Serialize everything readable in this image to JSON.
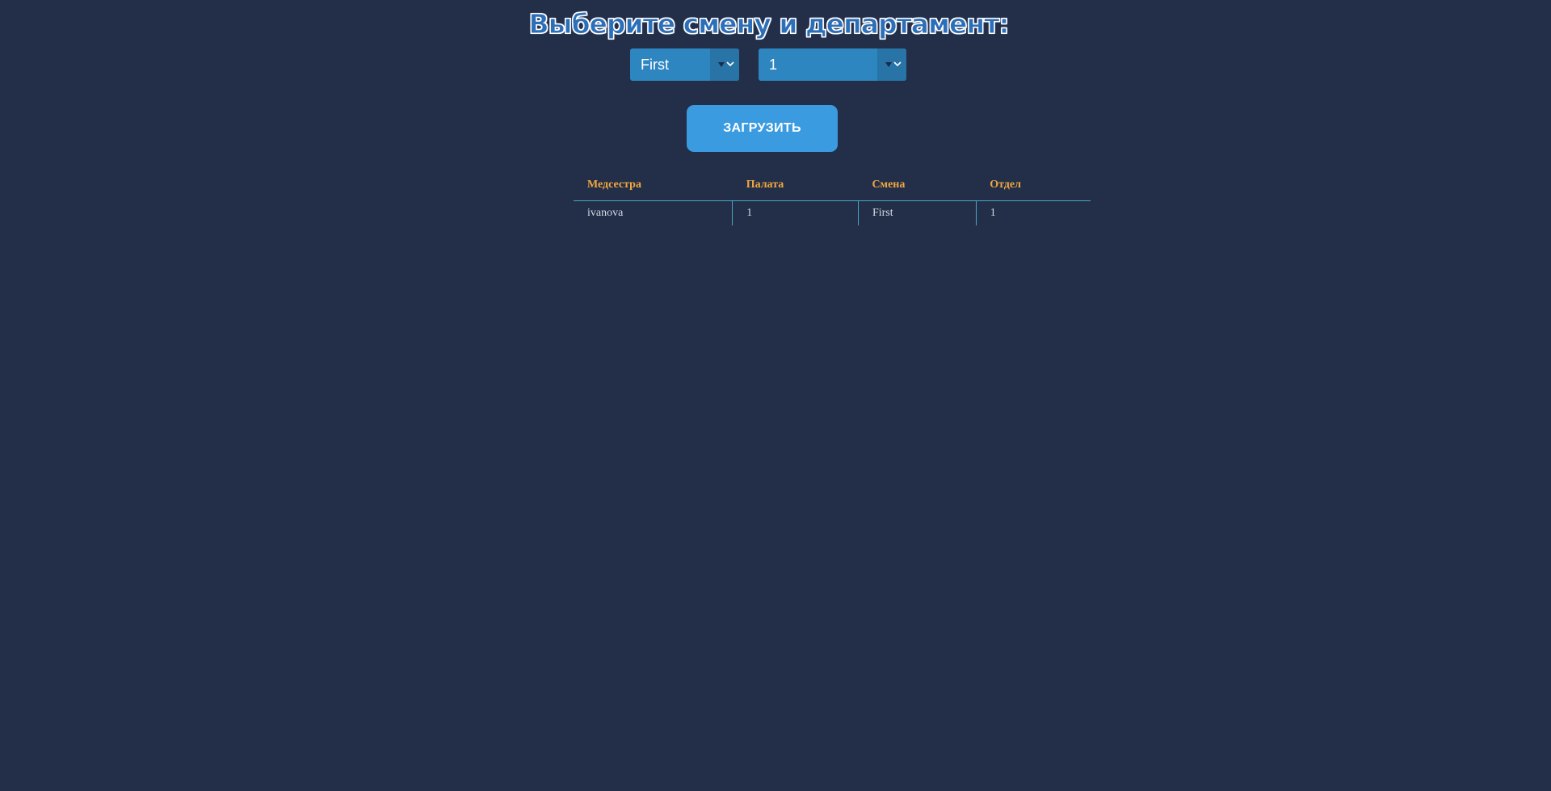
{
  "page": {
    "title": "Выберите смену и департамент:"
  },
  "filters": {
    "shift_select": {
      "value": "First",
      "options": [
        "First"
      ]
    },
    "department_select": {
      "value": "1",
      "options": [
        "1"
      ]
    }
  },
  "load_button_label": "ЗАГРУЗИТЬ",
  "table": {
    "headers": [
      "Медсестра",
      "Палата",
      "Смена",
      "Отдел"
    ],
    "rows": [
      [
        "ivanova",
        "1",
        "First",
        "1"
      ]
    ]
  },
  "colors": {
    "background": "#232e48",
    "select_bg": "#2e86c1",
    "button_bg": "#3a9be0",
    "header_text": "#f0a840",
    "table_border": "#4aa6c9"
  },
  "icons": {
    "select_arrow": "chevron-down-icon",
    "select_indicator": "caret-down-icon"
  }
}
